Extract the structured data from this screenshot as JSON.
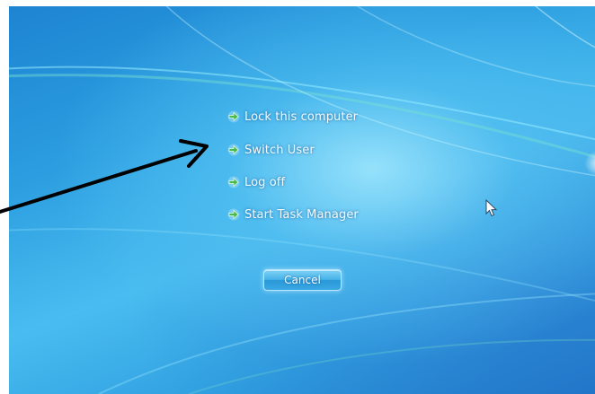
{
  "security_screen": {
    "options": [
      {
        "label": "Lock this computer",
        "icon": "green-arrow-icon"
      },
      {
        "label": "Switch User",
        "icon": "green-arrow-icon"
      },
      {
        "label": "Log off",
        "icon": "green-arrow-icon"
      },
      {
        "label": "Start Task Manager",
        "icon": "green-arrow-icon"
      }
    ],
    "cancel_label": "Cancel"
  },
  "colors": {
    "background_top": "#1d84d2",
    "background_center": "#49bdf0",
    "arrow_icon": "#4cb84c",
    "annotation_arrow": "#000000"
  },
  "overlays": {
    "annotation_arrow": "black-annotation-arrow",
    "cursor": "mouse-pointer-icon"
  }
}
